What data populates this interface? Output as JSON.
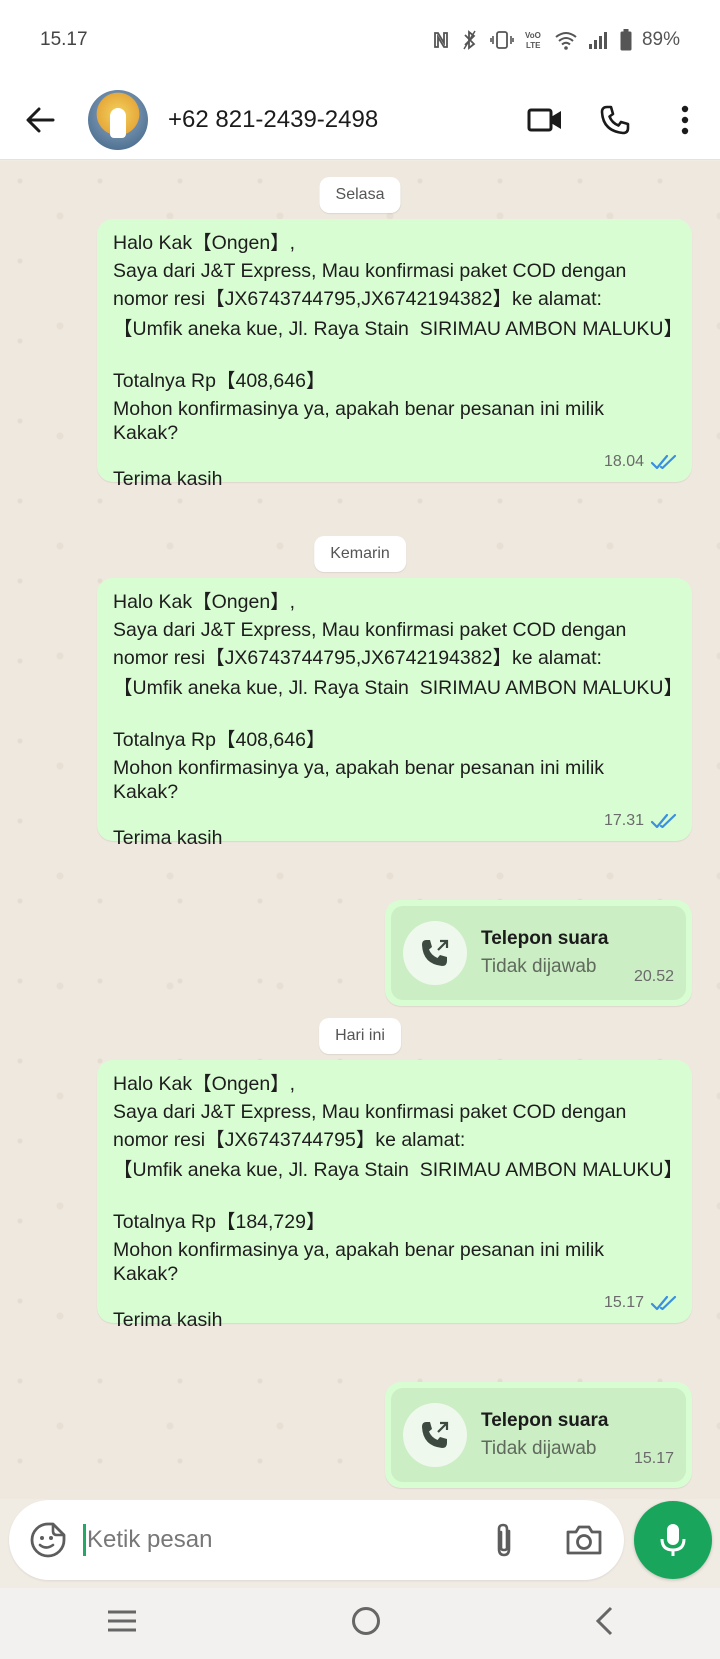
{
  "status_bar": {
    "time": "15.17",
    "battery": "89%",
    "icons": [
      "nfc-icon",
      "bluetooth-icon",
      "vibrate-icon",
      "volte-icon",
      "wifi-icon",
      "signal-icon",
      "battery-icon"
    ]
  },
  "header": {
    "contact": "+62 821-2439-2498",
    "icons": [
      "back-arrow-icon",
      "video-call-icon",
      "phone-icon",
      "more-vert-icon"
    ]
  },
  "chat": {
    "dates": [
      "Selasa",
      "Kemarin",
      "Hari ini"
    ],
    "messages": [
      {
        "lines": [
          "Halo Kak【Ongen】,",
          "Saya dari J&T Express, Mau konfirmasi paket COD dengan",
          "nomor resi【JX6743744795,JX6742194382】ke alamat:",
          "【Umfik aneka kue, Jl. Raya Stain  SIRIMAU AMBON MALUKU】",
          "Totalnya Rp【408,646】",
          "Mohon konfirmasinya ya, apakah benar pesanan ini milik",
          "Kakak?",
          "Terima kasih"
        ],
        "time": "18.04"
      },
      {
        "lines": [
          "Halo Kak【Ongen】,",
          "Saya dari J&T Express, Mau konfirmasi paket COD dengan",
          "nomor resi【JX6743744795,JX6742194382】ke alamat:",
          "【Umfik aneka kue, Jl. Raya Stain  SIRIMAU AMBON MALUKU】",
          "Totalnya Rp【408,646】",
          "Mohon konfirmasinya ya, apakah benar pesanan ini milik",
          "Kakak?",
          "Terima kasih"
        ],
        "time": "17.31"
      },
      {
        "lines": [
          "Halo Kak【Ongen】,",
          "Saya dari J&T Express, Mau konfirmasi paket COD dengan",
          "nomor resi【JX6743744795】ke alamat:",
          "【Umfik aneka kue, Jl. Raya Stain  SIRIMAU AMBON MALUKU】",
          "Totalnya Rp【184,729】",
          "Mohon konfirmasinya ya, apakah benar pesanan ini milik",
          "Kakak?",
          "Terima kasih"
        ],
        "time": "15.17"
      }
    ],
    "calls": [
      {
        "title": "Telepon suara",
        "status": "Tidak dijawab",
        "time": "20.52"
      },
      {
        "title": "Telepon suara",
        "status": "Tidak dijawab",
        "time": "15.17"
      }
    ],
    "read_receipt_color": "#3a8fe0",
    "bubble_color": "#d9fdd3"
  },
  "composer": {
    "placeholder": "Ketik pesan",
    "icons": [
      "sticker-icon",
      "attach-icon",
      "camera-icon",
      "mic-icon"
    ],
    "accent": "#1aa55c"
  },
  "nav_bar": {
    "icons": [
      "recent-apps-icon",
      "home-icon",
      "back-icon"
    ]
  }
}
